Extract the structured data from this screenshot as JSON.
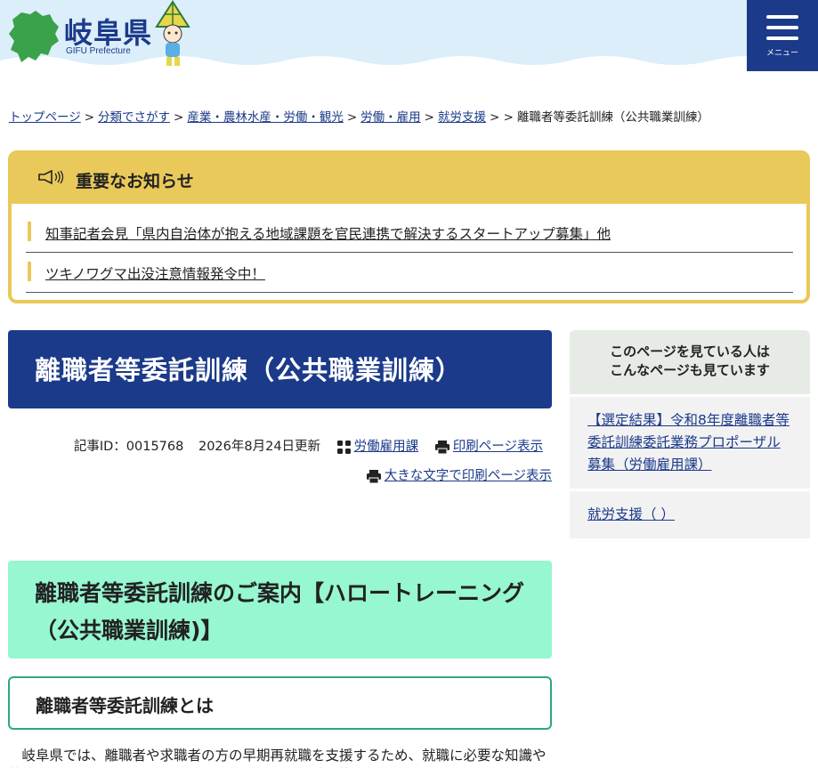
{
  "header": {
    "logo_text": "岐阜県",
    "logo_sub": "GIFU Prefecture",
    "menu_label": "メニュー"
  },
  "breadcrumb": {
    "items": [
      "トップページ",
      "分類でさがす",
      "産業・農林水産・労働・観光",
      "労働・雇用",
      "就労支援"
    ],
    "current": "離職者等委託訓練（公共職業訓練）"
  },
  "notice": {
    "title": "重要なお知らせ",
    "items": [
      "知事記者会見「県内自治体が抱える地域課題を官民連携で解決するスタートアップ募集」他",
      "ツキノワグマ出没注意情報発令中！"
    ]
  },
  "page": {
    "title": "離職者等委託訓練（公共職業訓練）",
    "article_id": "記事ID：0015768",
    "updated": "2026年8月24日更新",
    "department": "労働雇用課",
    "print_label": "印刷ページ表示",
    "print_large_label": "大きな文字で印刷ページ表示"
  },
  "content": {
    "h2": "離職者等委託訓練のご案内【ハロートレーニング（公共職業訓練)】",
    "h3": "離職者等委託訓練とは",
    "paragraph": "岐阜県では、離職者や求職者の方の早期再就職を支援するため、就職に必要な知識や技能を身に付けていただくことを目的として「離職者等委託訓練」を実施しています。"
  },
  "side": {
    "heading_line1": "このページを見ている人は",
    "heading_line2": "こんなページも見ています",
    "links": [
      "【選定結果】令和8年度離職者等委託訓練委託業務プロポーザル募集（労働雇用課）",
      "就労支援（  ）"
    ]
  },
  "colors": {
    "brand": "#1b3a8a",
    "notice": "#e9c95a",
    "h2_bg": "#96f7d0",
    "h3_border": "#2ea87b"
  }
}
